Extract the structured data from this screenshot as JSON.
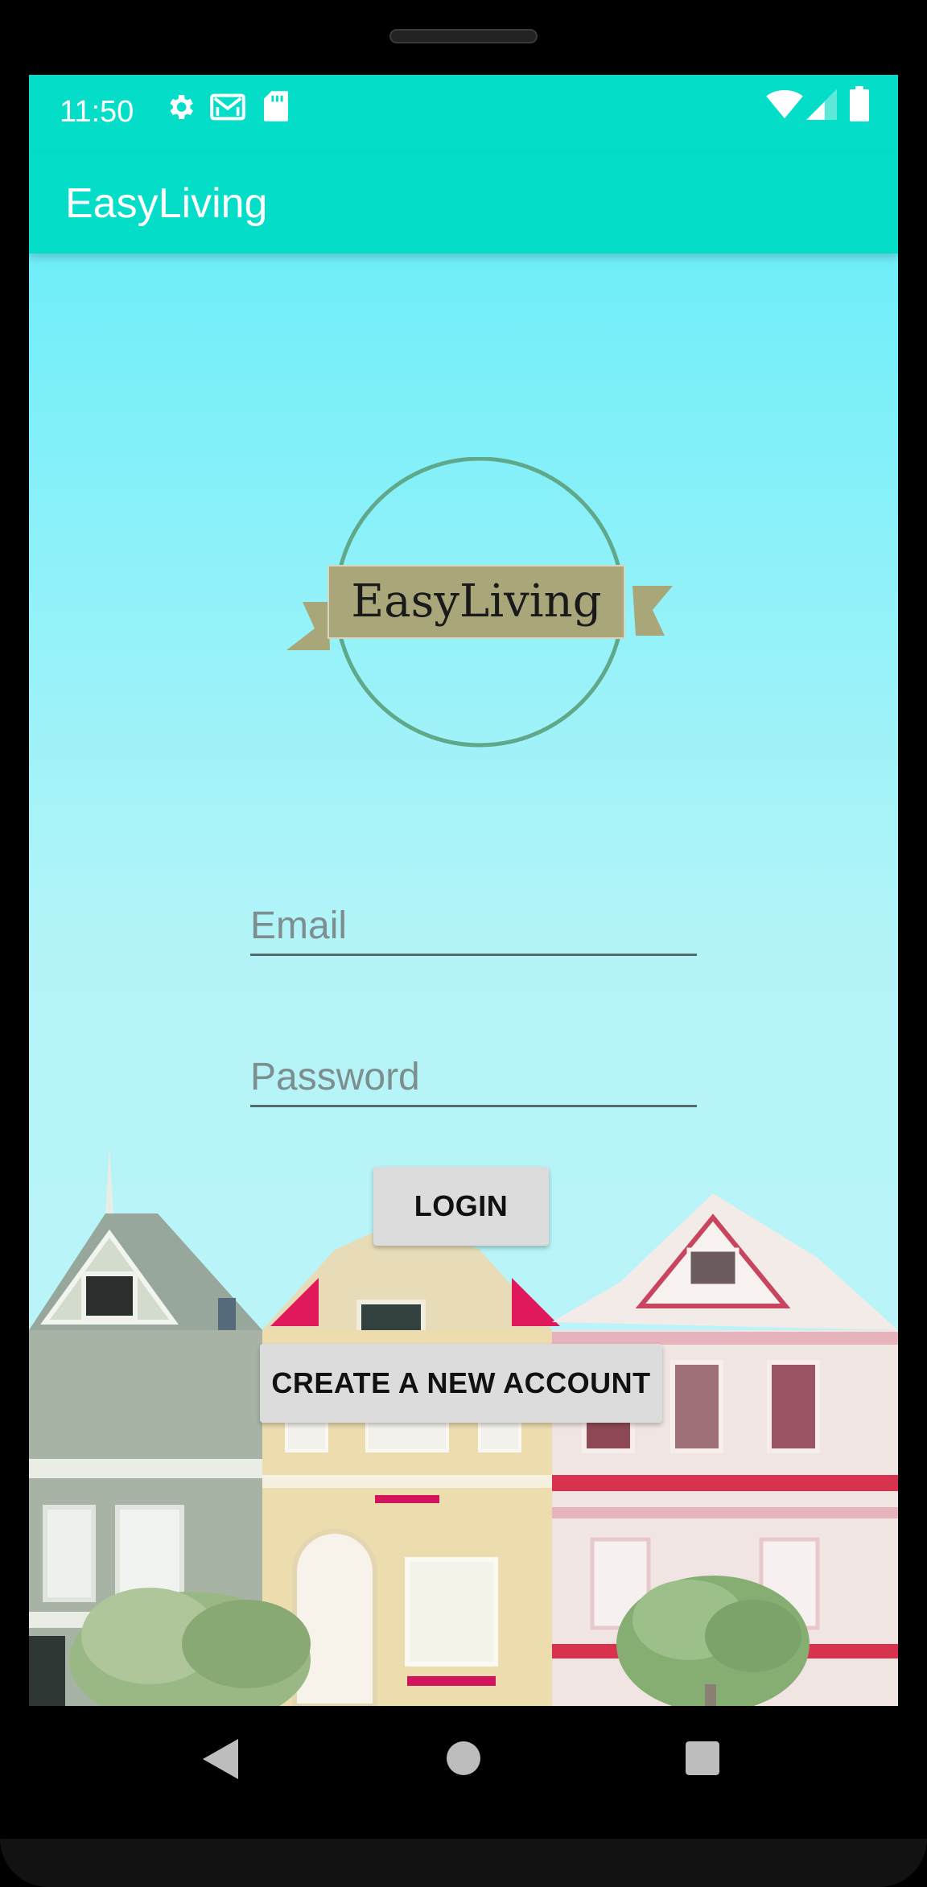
{
  "status_bar": {
    "time": "11:50",
    "left_icons": [
      "settings-icon",
      "gmail-icon",
      "sd-card-icon"
    ],
    "right_icons": [
      "wifi-icon",
      "cell-signal-icon",
      "battery-icon"
    ]
  },
  "app_bar": {
    "title": "EasyLiving"
  },
  "logo": {
    "text": "EasyLiving",
    "ring_color": "#5fa88a",
    "banner_color": "#a9a77a"
  },
  "form": {
    "email_placeholder": "Email",
    "password_placeholder": "Password",
    "login_label": "LOGIN",
    "create_account_label": "CREATE A NEW ACCOUNT"
  },
  "nav_bar": {
    "icons": [
      "back-icon",
      "home-icon",
      "recents-icon"
    ]
  },
  "colors": {
    "accent": "#04dec8",
    "sky": "#5cecf9"
  }
}
